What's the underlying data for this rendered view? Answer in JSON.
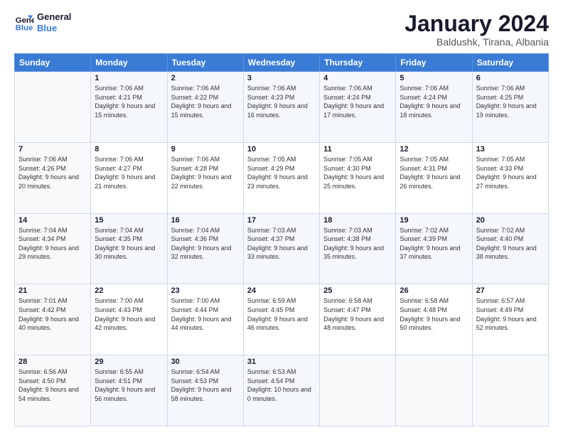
{
  "logo": {
    "line1": "General",
    "line2": "Blue"
  },
  "header": {
    "title": "January 2024",
    "subtitle": "Baldushk, Tirana, Albania"
  },
  "weekdays": [
    "Sunday",
    "Monday",
    "Tuesday",
    "Wednesday",
    "Thursday",
    "Friday",
    "Saturday"
  ],
  "weeks": [
    [
      {
        "day": "",
        "sunrise": "",
        "sunset": "",
        "daylight": ""
      },
      {
        "day": "1",
        "sunrise": "Sunrise: 7:06 AM",
        "sunset": "Sunset: 4:21 PM",
        "daylight": "Daylight: 9 hours and 15 minutes."
      },
      {
        "day": "2",
        "sunrise": "Sunrise: 7:06 AM",
        "sunset": "Sunset: 4:22 PM",
        "daylight": "Daylight: 9 hours and 15 minutes."
      },
      {
        "day": "3",
        "sunrise": "Sunrise: 7:06 AM",
        "sunset": "Sunset: 4:23 PM",
        "daylight": "Daylight: 9 hours and 16 minutes."
      },
      {
        "day": "4",
        "sunrise": "Sunrise: 7:06 AM",
        "sunset": "Sunset: 4:24 PM",
        "daylight": "Daylight: 9 hours and 17 minutes."
      },
      {
        "day": "5",
        "sunrise": "Sunrise: 7:06 AM",
        "sunset": "Sunset: 4:24 PM",
        "daylight": "Daylight: 9 hours and 18 minutes."
      },
      {
        "day": "6",
        "sunrise": "Sunrise: 7:06 AM",
        "sunset": "Sunset: 4:25 PM",
        "daylight": "Daylight: 9 hours and 19 minutes."
      }
    ],
    [
      {
        "day": "7",
        "sunrise": "Sunrise: 7:06 AM",
        "sunset": "Sunset: 4:26 PM",
        "daylight": "Daylight: 9 hours and 20 minutes."
      },
      {
        "day": "8",
        "sunrise": "Sunrise: 7:06 AM",
        "sunset": "Sunset: 4:27 PM",
        "daylight": "Daylight: 9 hours and 21 minutes."
      },
      {
        "day": "9",
        "sunrise": "Sunrise: 7:06 AM",
        "sunset": "Sunset: 4:28 PM",
        "daylight": "Daylight: 9 hours and 22 minutes."
      },
      {
        "day": "10",
        "sunrise": "Sunrise: 7:05 AM",
        "sunset": "Sunset: 4:29 PM",
        "daylight": "Daylight: 9 hours and 23 minutes."
      },
      {
        "day": "11",
        "sunrise": "Sunrise: 7:05 AM",
        "sunset": "Sunset: 4:30 PM",
        "daylight": "Daylight: 9 hours and 25 minutes."
      },
      {
        "day": "12",
        "sunrise": "Sunrise: 7:05 AM",
        "sunset": "Sunset: 4:31 PM",
        "daylight": "Daylight: 9 hours and 26 minutes."
      },
      {
        "day": "13",
        "sunrise": "Sunrise: 7:05 AM",
        "sunset": "Sunset: 4:33 PM",
        "daylight": "Daylight: 9 hours and 27 minutes."
      }
    ],
    [
      {
        "day": "14",
        "sunrise": "Sunrise: 7:04 AM",
        "sunset": "Sunset: 4:34 PM",
        "daylight": "Daylight: 9 hours and 29 minutes."
      },
      {
        "day": "15",
        "sunrise": "Sunrise: 7:04 AM",
        "sunset": "Sunset: 4:35 PM",
        "daylight": "Daylight: 9 hours and 30 minutes."
      },
      {
        "day": "16",
        "sunrise": "Sunrise: 7:04 AM",
        "sunset": "Sunset: 4:36 PM",
        "daylight": "Daylight: 9 hours and 32 minutes."
      },
      {
        "day": "17",
        "sunrise": "Sunrise: 7:03 AM",
        "sunset": "Sunset: 4:37 PM",
        "daylight": "Daylight: 9 hours and 33 minutes."
      },
      {
        "day": "18",
        "sunrise": "Sunrise: 7:03 AM",
        "sunset": "Sunset: 4:38 PM",
        "daylight": "Daylight: 9 hours and 35 minutes."
      },
      {
        "day": "19",
        "sunrise": "Sunrise: 7:02 AM",
        "sunset": "Sunset: 4:39 PM",
        "daylight": "Daylight: 9 hours and 37 minutes."
      },
      {
        "day": "20",
        "sunrise": "Sunrise: 7:02 AM",
        "sunset": "Sunset: 4:40 PM",
        "daylight": "Daylight: 9 hours and 38 minutes."
      }
    ],
    [
      {
        "day": "21",
        "sunrise": "Sunrise: 7:01 AM",
        "sunset": "Sunset: 4:42 PM",
        "daylight": "Daylight: 9 hours and 40 minutes."
      },
      {
        "day": "22",
        "sunrise": "Sunrise: 7:00 AM",
        "sunset": "Sunset: 4:43 PM",
        "daylight": "Daylight: 9 hours and 42 minutes."
      },
      {
        "day": "23",
        "sunrise": "Sunrise: 7:00 AM",
        "sunset": "Sunset: 4:44 PM",
        "daylight": "Daylight: 9 hours and 44 minutes."
      },
      {
        "day": "24",
        "sunrise": "Sunrise: 6:59 AM",
        "sunset": "Sunset: 4:45 PM",
        "daylight": "Daylight: 9 hours and 46 minutes."
      },
      {
        "day": "25",
        "sunrise": "Sunrise: 6:58 AM",
        "sunset": "Sunset: 4:47 PM",
        "daylight": "Daylight: 9 hours and 48 minutes."
      },
      {
        "day": "26",
        "sunrise": "Sunrise: 6:58 AM",
        "sunset": "Sunset: 4:48 PM",
        "daylight": "Daylight: 9 hours and 50 minutes."
      },
      {
        "day": "27",
        "sunrise": "Sunrise: 6:57 AM",
        "sunset": "Sunset: 4:49 PM",
        "daylight": "Daylight: 9 hours and 52 minutes."
      }
    ],
    [
      {
        "day": "28",
        "sunrise": "Sunrise: 6:56 AM",
        "sunset": "Sunset: 4:50 PM",
        "daylight": "Daylight: 9 hours and 54 minutes."
      },
      {
        "day": "29",
        "sunrise": "Sunrise: 6:55 AM",
        "sunset": "Sunset: 4:51 PM",
        "daylight": "Daylight: 9 hours and 56 minutes."
      },
      {
        "day": "30",
        "sunrise": "Sunrise: 6:54 AM",
        "sunset": "Sunset: 4:53 PM",
        "daylight": "Daylight: 9 hours and 58 minutes."
      },
      {
        "day": "31",
        "sunrise": "Sunrise: 6:53 AM",
        "sunset": "Sunset: 4:54 PM",
        "daylight": "Daylight: 10 hours and 0 minutes."
      },
      {
        "day": "",
        "sunrise": "",
        "sunset": "",
        "daylight": ""
      },
      {
        "day": "",
        "sunrise": "",
        "sunset": "",
        "daylight": ""
      },
      {
        "day": "",
        "sunrise": "",
        "sunset": "",
        "daylight": ""
      }
    ]
  ]
}
